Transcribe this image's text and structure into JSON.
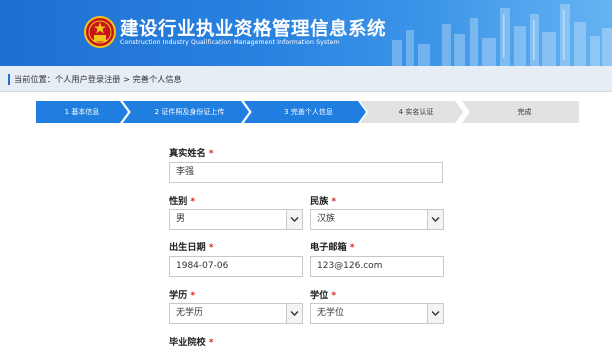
{
  "header": {
    "title_cn": "建设行业执业资格管理信息系统",
    "title_en": "Construction Industry Qualification Management Information System",
    "emblem_icon": "national-emblem-icon"
  },
  "breadcrumb": {
    "prefix": "当前位置：",
    "items": [
      "个人用户登录注册",
      "完善个人信息"
    ],
    "separator": ">"
  },
  "steps": [
    {
      "label": "1 基本信息",
      "state": "done"
    },
    {
      "label": "2 证件照及身份证上传",
      "state": "done"
    },
    {
      "label": "3 完善个人信息",
      "state": "current"
    },
    {
      "label": "4 实名认证",
      "state": "todo"
    },
    {
      "label": "完成",
      "state": "todo"
    }
  ],
  "colors": {
    "header_blue": "#2a83e0",
    "step_active": "#1f7ee0",
    "step_inactive": "#e2e2e2",
    "required": "#e02020"
  },
  "form": {
    "real_name": {
      "label": "真实姓名",
      "required": "*",
      "value": "李强"
    },
    "gender": {
      "label": "性别",
      "required": "*",
      "value": "男"
    },
    "ethnicity": {
      "label": "民族",
      "required": "*",
      "value": "汉族"
    },
    "birth_date": {
      "label": "出生日期",
      "required": "*",
      "value": "1984-07-06"
    },
    "email": {
      "label": "电子邮箱",
      "required": "*",
      "value": "123@126.com"
    },
    "education": {
      "label": "学历",
      "required": "*",
      "value": "无学历"
    },
    "degree": {
      "label": "学位",
      "required": "*",
      "value": "无学位"
    },
    "school": {
      "label": "毕业院校",
      "required": "*"
    }
  }
}
